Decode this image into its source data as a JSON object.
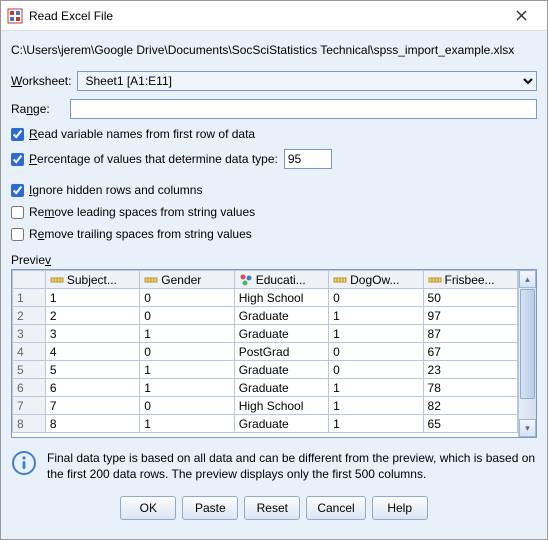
{
  "window": {
    "title": "Read Excel File"
  },
  "filepath": "C:\\Users\\jerem\\Google Drive\\Documents\\SocSciStatistics Technical\\spss_import_example.xlsx",
  "worksheet": {
    "label": "Worksheet:",
    "label_ul": "W",
    "selected": "Sheet1 [A1:E11]"
  },
  "range": {
    "label": "Range:",
    "label_ul": "n",
    "value": ""
  },
  "options": {
    "read_varnames": {
      "checked": true,
      "label": "Read variable names from first row of data",
      "ul": "R"
    },
    "pct_types": {
      "checked": true,
      "label": "Percentage of values that determine data type:",
      "ul": "P",
      "value": "95"
    },
    "ignore_hidden": {
      "checked": true,
      "label": "Ignore hidden rows and columns",
      "ul": "I"
    },
    "remove_leading": {
      "checked": false,
      "label": "Remove leading spaces from string values",
      "ul": "m"
    },
    "remove_trailing": {
      "checked": false,
      "label": "Remove trailing spaces from string values",
      "ul": "e"
    }
  },
  "preview": {
    "label": "Preview",
    "label_ul": "v",
    "columns": [
      "Subject...",
      "Gender",
      "Educati...",
      "DogOw...",
      "Frisbee..."
    ],
    "col_types": [
      "ruler",
      "ruler",
      "nominal",
      "ruler",
      "ruler"
    ],
    "rows": [
      {
        "n": "1",
        "c": [
          "1",
          "0",
          "High School",
          "0",
          "50"
        ]
      },
      {
        "n": "2",
        "c": [
          "2",
          "0",
          "Graduate",
          "1",
          "97"
        ]
      },
      {
        "n": "3",
        "c": [
          "3",
          "1",
          "Graduate",
          "1",
          "87"
        ]
      },
      {
        "n": "4",
        "c": [
          "4",
          "0",
          "PostGrad",
          "0",
          "67"
        ]
      },
      {
        "n": "5",
        "c": [
          "5",
          "1",
          "Graduate",
          "0",
          "23"
        ]
      },
      {
        "n": "6",
        "c": [
          "6",
          "1",
          "Graduate",
          "1",
          "78"
        ]
      },
      {
        "n": "7",
        "c": [
          "7",
          "0",
          "High School",
          "1",
          "82"
        ]
      },
      {
        "n": "8",
        "c": [
          "8",
          "1",
          "Graduate",
          "1",
          "65"
        ]
      }
    ]
  },
  "info": "Final data type is based on all data and can be different from the preview, which is based on the first 200 data rows. The preview displays only the first 500 columns.",
  "buttons": {
    "ok": "OK",
    "paste": "Paste",
    "reset": "Reset",
    "cancel": "Cancel",
    "help": "Help"
  }
}
